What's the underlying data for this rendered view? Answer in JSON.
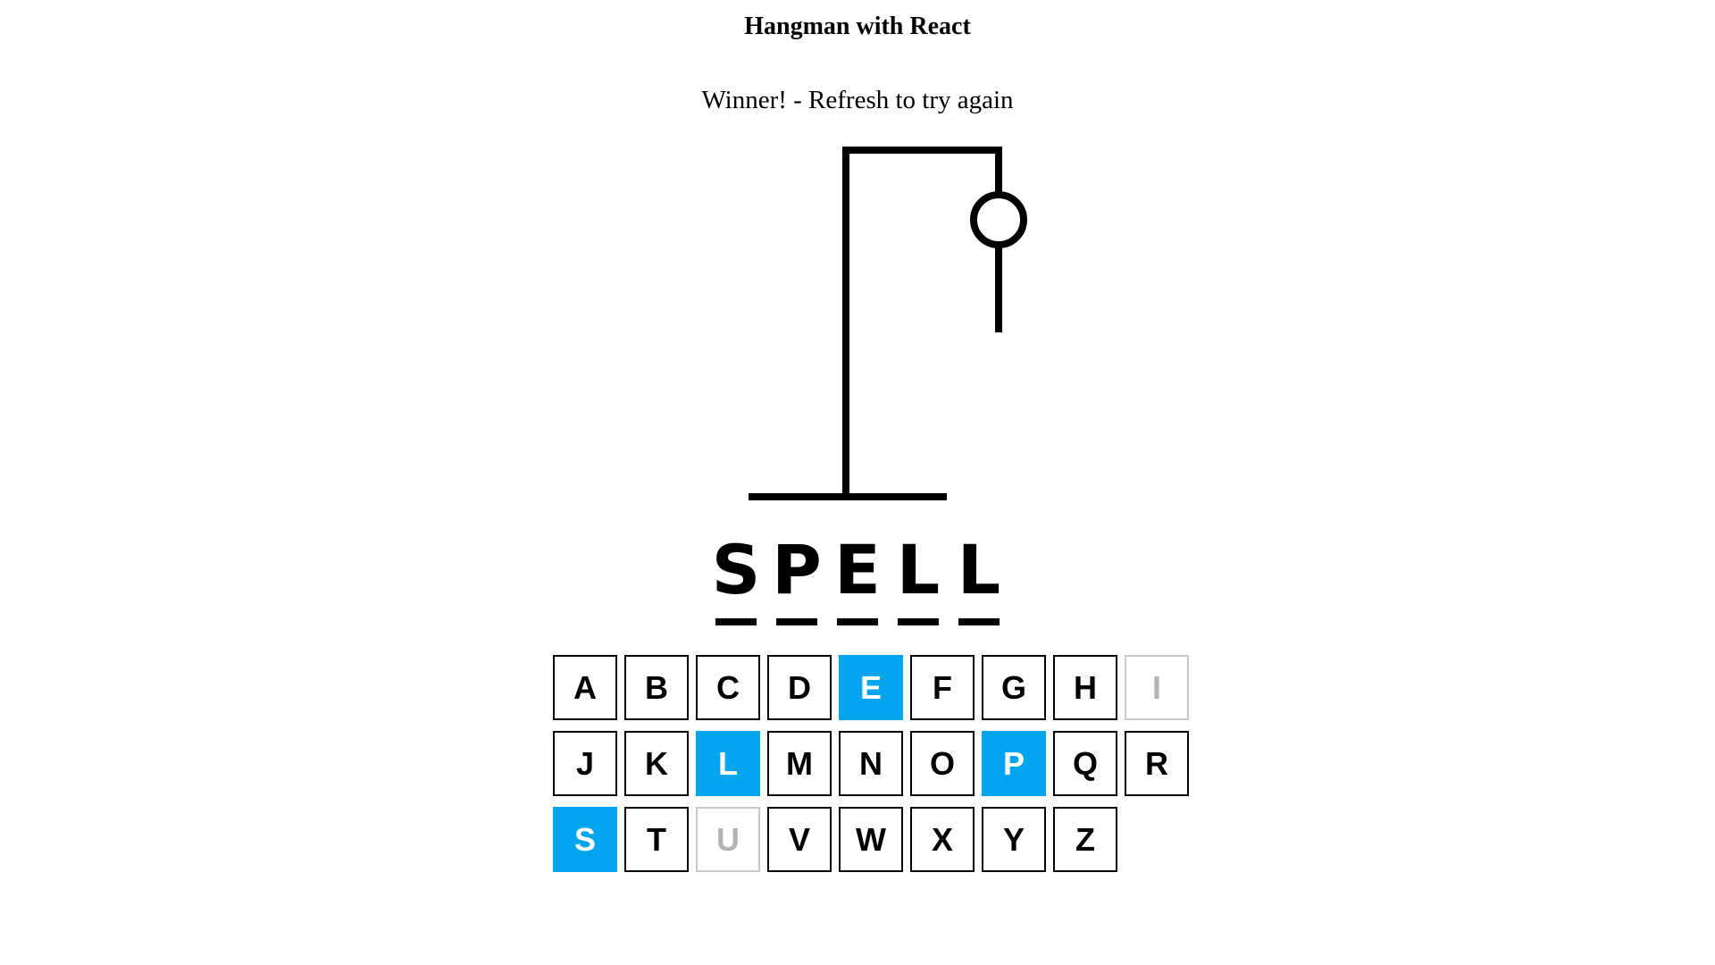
{
  "header": {
    "title": "Hangman with React"
  },
  "status": {
    "message": "Winner! - Refresh to try again"
  },
  "word": {
    "letters": [
      "S",
      "P",
      "E",
      "L",
      "L"
    ]
  },
  "keyboard": {
    "keys": [
      {
        "letter": "A",
        "state": "available"
      },
      {
        "letter": "B",
        "state": "available"
      },
      {
        "letter": "C",
        "state": "available"
      },
      {
        "letter": "D",
        "state": "available"
      },
      {
        "letter": "E",
        "state": "correct"
      },
      {
        "letter": "F",
        "state": "available"
      },
      {
        "letter": "G",
        "state": "available"
      },
      {
        "letter": "H",
        "state": "available"
      },
      {
        "letter": "I",
        "state": "disabled"
      },
      {
        "letter": "J",
        "state": "available"
      },
      {
        "letter": "K",
        "state": "available"
      },
      {
        "letter": "L",
        "state": "correct"
      },
      {
        "letter": "M",
        "state": "available"
      },
      {
        "letter": "N",
        "state": "available"
      },
      {
        "letter": "O",
        "state": "available"
      },
      {
        "letter": "P",
        "state": "correct"
      },
      {
        "letter": "Q",
        "state": "available"
      },
      {
        "letter": "R",
        "state": "available"
      },
      {
        "letter": "S",
        "state": "correct"
      },
      {
        "letter": "T",
        "state": "available"
      },
      {
        "letter": "U",
        "state": "disabled"
      },
      {
        "letter": "V",
        "state": "available"
      },
      {
        "letter": "W",
        "state": "available"
      },
      {
        "letter": "X",
        "state": "available"
      },
      {
        "letter": "Y",
        "state": "available"
      },
      {
        "letter": "Z",
        "state": "available"
      }
    ]
  },
  "colors": {
    "correct": "#00a4ef",
    "disabled_border": "#c8c8c8",
    "disabled_text": "#b3b3b3",
    "ink": "#000000"
  }
}
